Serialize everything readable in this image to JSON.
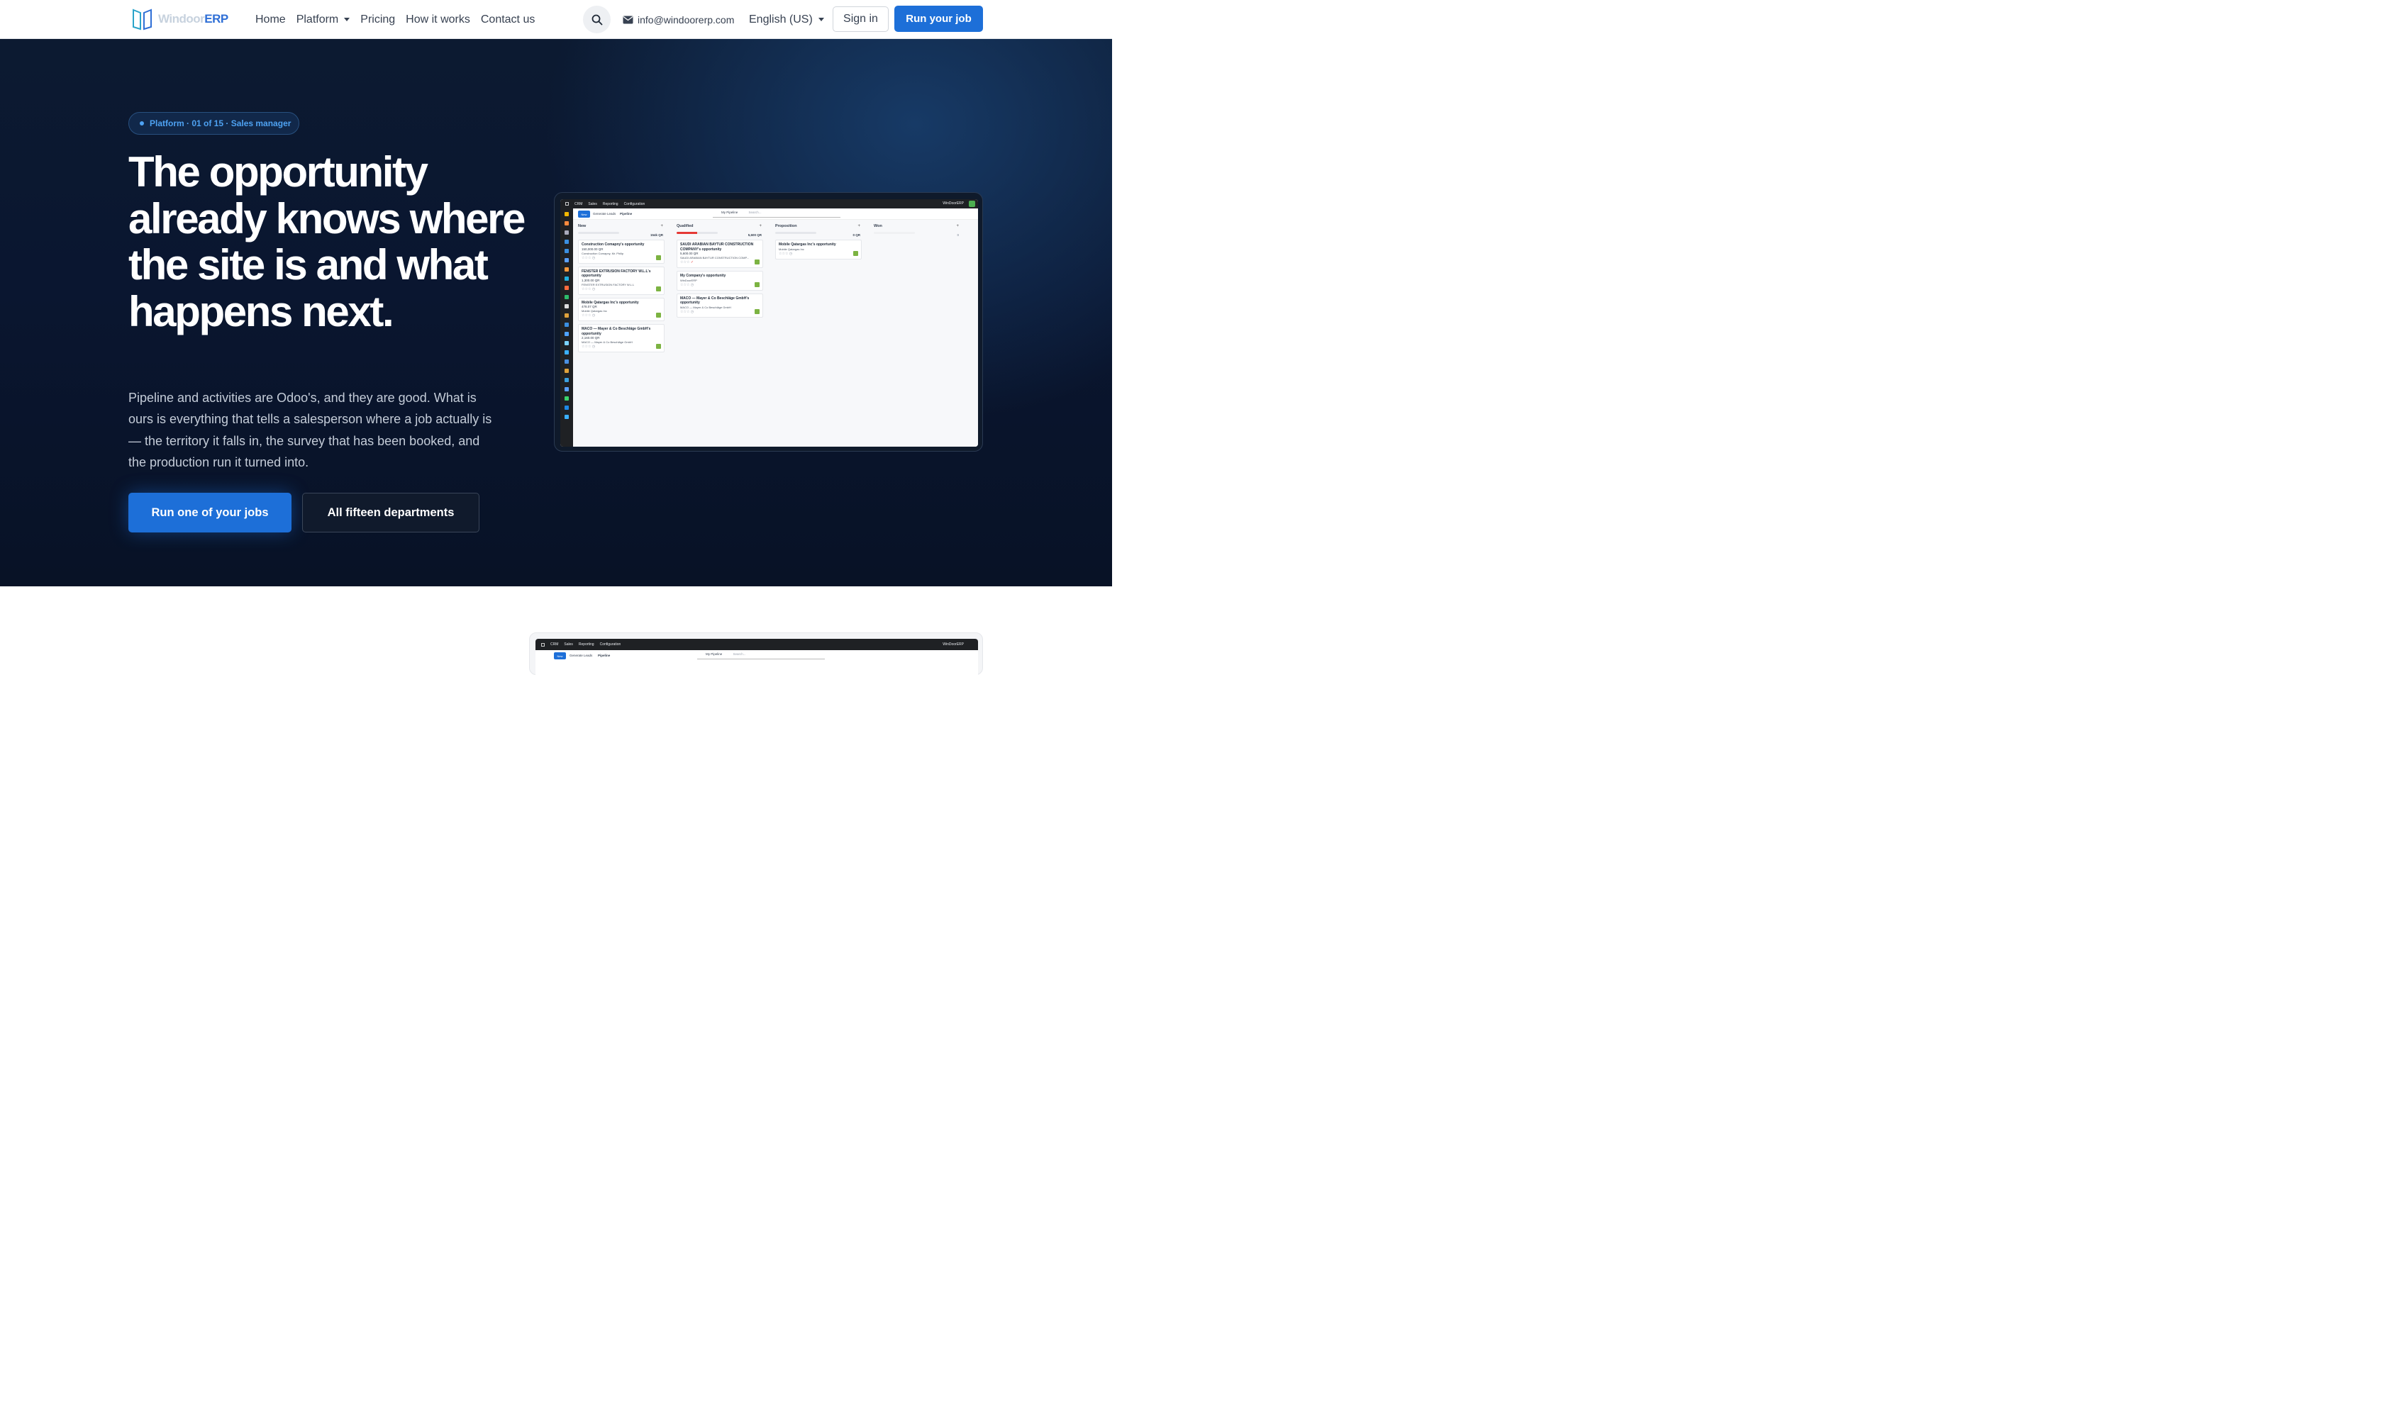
{
  "nav": {
    "logo_windoor": "Windoor",
    "logo_erp": "ERP",
    "links": [
      "Home",
      "Platform",
      "Pricing",
      "How it works",
      "Contact us"
    ],
    "email": "info@windoorerp.com",
    "language": "English (US)",
    "sign_in": "Sign in",
    "cta": "Run your job"
  },
  "hero": {
    "badge": "Platform · 01 of 15 · Sales manager",
    "headline": "The opportunity already knows where the site is and what happens next.",
    "lead": "Pipeline and activities are Odoo's, and they are good. What is ours is everything that tells a salesperson where a job actually is — the territory it falls in, the survey that has been booked, and the production run it turned into.",
    "primary_button": "Run one of your jobs",
    "secondary_button": "All fifteen departments"
  },
  "mockup": {
    "menu": [
      "CRM",
      "Sales",
      "Reporting",
      "Configuration"
    ],
    "user": "WinDoorERP",
    "new": "New",
    "generate_leads": "Generate Leads",
    "pipeline": "Pipeline",
    "filter": "My Pipeline",
    "search_placeholder": "Search...",
    "columns": [
      {
        "name": "New",
        "sum": "154k QR",
        "cards": [
          {
            "title": "Construction Comapny's opportunity",
            "amount": "150,000.00 QR",
            "company": "Construction Comapny, Mr. Philip"
          },
          {
            "title": "FENSTER EXTRUSION FACTORY W.L.L's opportunity",
            "amount": "1,300.00 QR",
            "company": "FENSTER EXTRUSION FACTORY W.L.L"
          },
          {
            "title": "Mobile Qatargas Inc's opportunity",
            "amount": "478.07 QR",
            "company": "Mobile Qatargas Inc"
          },
          {
            "title": "MACO — Mayer & Co Beschläge GmbH's opportunity",
            "amount": "2,160.00 QR",
            "company": "MACO — Mayer & Co Beschläge GmbH"
          }
        ]
      },
      {
        "name": "Qualified",
        "sum": "5,600 QR",
        "cards": [
          {
            "title": "SAUDI ARABIAN BAYTUR CONSTRUCTION COMPANY's opportunity",
            "amount": "5,600.00 QR",
            "company": "SAUDI ARABIAN BAYTUR CONSTRUCTION COMP..."
          },
          {
            "title": "My Company's opportunity",
            "amount": "",
            "company": "WinDoorERP"
          },
          {
            "title": "MACO — Mayer & Co Beschläge GmbH's opportunity",
            "amount": "",
            "company": "MACO — Mayer & Co Beschläge GmbH"
          }
        ]
      },
      {
        "name": "Proposition",
        "sum": "0 QR",
        "cards": [
          {
            "title": "Mobile Qatargas Inc's opportunity",
            "amount": "",
            "company": "Mobile Qatargas Inc"
          }
        ]
      },
      {
        "name": "Won",
        "sum": "0",
        "cards": []
      }
    ]
  },
  "colors": {
    "brand": "#1d6fd8",
    "hero_bg": "#0a1630",
    "badge_text": "#4ea2f2"
  }
}
